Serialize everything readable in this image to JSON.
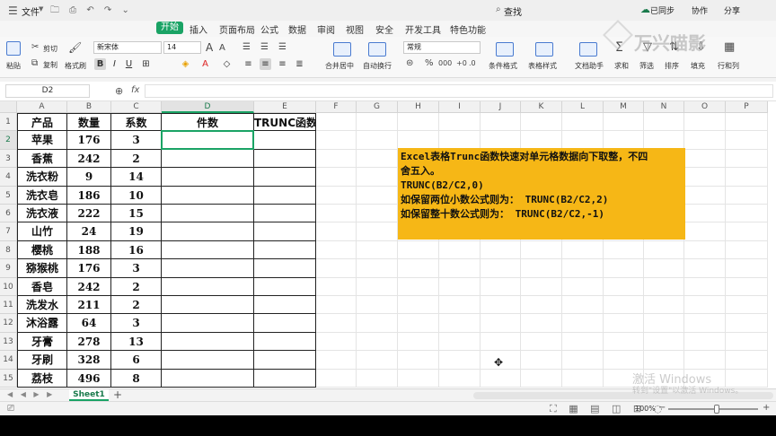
{
  "titlebar": {
    "file_menu": "文件",
    "search": "查找",
    "cloud": "已同步",
    "collab": "协作",
    "share": "分享"
  },
  "menu": [
    "开始",
    "插入",
    "页面布局",
    "公式",
    "数据",
    "审阅",
    "视图",
    "安全",
    "开发工具",
    "特色功能"
  ],
  "active_menu_index": 0,
  "ribbon": {
    "paste": "粘贴",
    "cut": "剪切",
    "copy": "复制",
    "format_painter": "格式刷",
    "font_name": "新宋体",
    "font_size": "14",
    "merge_center": "合并居中",
    "wrap_text": "自动换行",
    "number_format": "常规",
    "conditional_format": "条件格式",
    "table_style": "表格样式",
    "doc_assistant": "文档助手",
    "sum": "求和",
    "filter": "筛选",
    "sort": "排序",
    "fill": "填充",
    "rows_cols": "行和列"
  },
  "formula_bar": {
    "name_box": "D2",
    "fx": "fx",
    "value": ""
  },
  "columns": [
    "A",
    "B",
    "C",
    "D",
    "E",
    "F",
    "G",
    "H",
    "I",
    "J",
    "K",
    "L",
    "M",
    "N",
    "O",
    "P"
  ],
  "selected_column": "D",
  "rows": [
    {
      "n": "1",
      "cells": [
        "产品",
        "数量",
        "系数",
        "件数",
        "TRUNC函数"
      ]
    },
    {
      "n": "2",
      "cells": [
        "苹果",
        "176",
        "3",
        "",
        ""
      ]
    },
    {
      "n": "3",
      "cells": [
        "香蕉",
        "242",
        "2",
        "",
        ""
      ]
    },
    {
      "n": "4",
      "cells": [
        "洗衣粉",
        "9",
        "14",
        "",
        ""
      ]
    },
    {
      "n": "5",
      "cells": [
        "洗衣皂",
        "186",
        "10",
        "",
        ""
      ]
    },
    {
      "n": "6",
      "cells": [
        "洗衣液",
        "222",
        "15",
        "",
        ""
      ]
    },
    {
      "n": "7",
      "cells": [
        "山竹",
        "24",
        "19",
        "",
        ""
      ]
    },
    {
      "n": "8",
      "cells": [
        "樱桃",
        "188",
        "16",
        "",
        ""
      ]
    },
    {
      "n": "9",
      "cells": [
        "猕猴桃",
        "176",
        "3",
        "",
        ""
      ]
    },
    {
      "n": "10",
      "cells": [
        "香皂",
        "242",
        "2",
        "",
        ""
      ]
    },
    {
      "n": "11",
      "cells": [
        "洗发水",
        "211",
        "2",
        "",
        ""
      ]
    },
    {
      "n": "12",
      "cells": [
        "沐浴露",
        "64",
        "3",
        "",
        ""
      ]
    },
    {
      "n": "13",
      "cells": [
        "牙膏",
        "278",
        "13",
        "",
        ""
      ]
    },
    {
      "n": "14",
      "cells": [
        "牙刷",
        "328",
        "6",
        "",
        ""
      ]
    },
    {
      "n": "15",
      "cells": [
        "荔枝",
        "496",
        "8",
        "",
        ""
      ]
    }
  ],
  "selected_row": "2",
  "note_lines": [
    "Excel表格Trunc函数快速对单元格数据向下取整，不四",
    "舍五入。",
    "TRUNC(B2/C2,0)",
    "如保留两位小数公式则为：  TRUNC(B2/C2,2)",
    "如保留整十数公式则为：    TRUNC(B2/C2,-1)"
  ],
  "sheet_tab": "Sheet1",
  "add_sheet": "+",
  "zoom": "100%",
  "watermarks": {
    "brand": "万兴喵影",
    "windows_1": "激活 Windows",
    "windows_2": "转到\"设置\"以激活 Windows。"
  },
  "colors": {
    "accent": "#1aa365",
    "note_bg": "#f6b716"
  }
}
